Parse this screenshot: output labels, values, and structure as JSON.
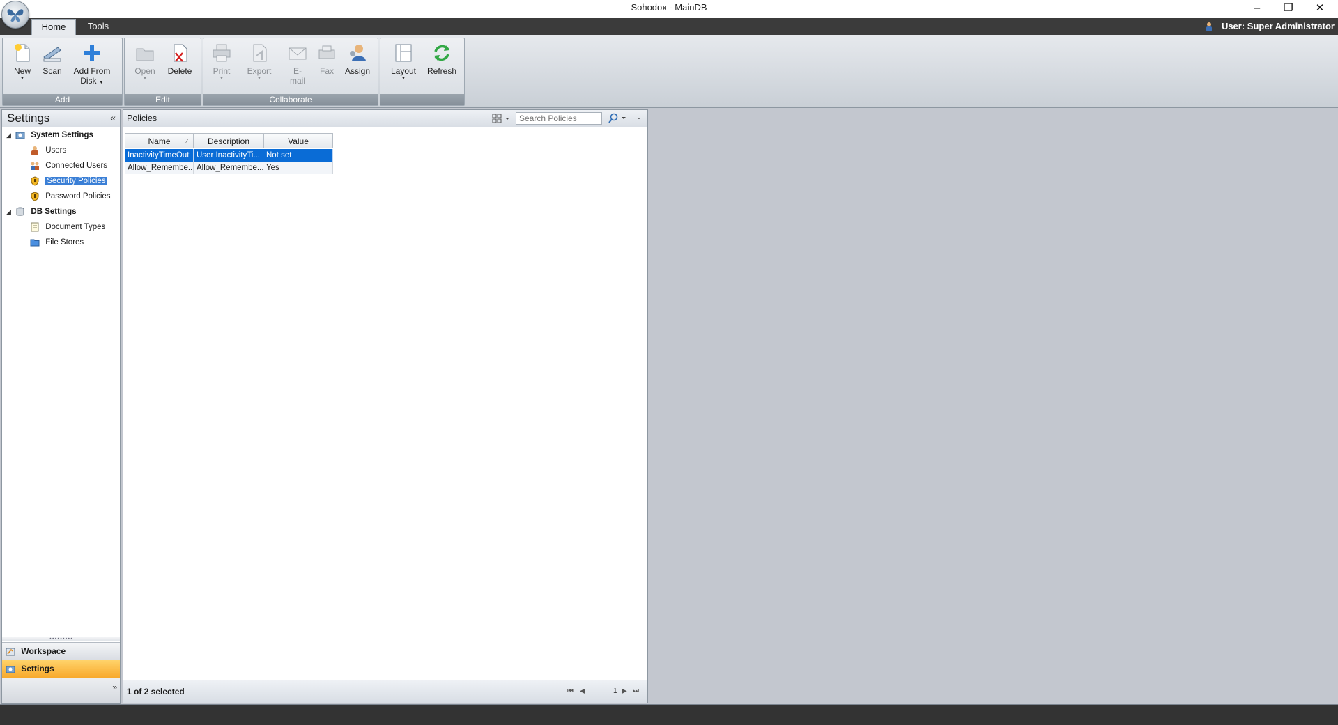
{
  "window": {
    "title": "Sohodox - MainDB",
    "minimize": "–",
    "restore": "❐",
    "close": "✕"
  },
  "tabs": {
    "home": "Home",
    "tools": "Tools"
  },
  "user": {
    "label": "User: Super Administrator"
  },
  "ribbon": {
    "add": {
      "label": "Add",
      "new": "New",
      "scan": "Scan",
      "add_from_disk_1": "Add From",
      "add_from_disk_2": "Disk"
    },
    "edit": {
      "label": "Edit",
      "open": "Open",
      "delete": "Delete"
    },
    "collaborate": {
      "label": "Collaborate",
      "print": "Print",
      "export": "Export",
      "email_1": "E-",
      "email_2": "mail",
      "fax": "Fax",
      "assign": "Assign"
    },
    "view": {
      "layout": "Layout",
      "refresh": "Refresh"
    }
  },
  "settings": {
    "title": "Settings",
    "collapse": "«",
    "system_settings": {
      "label": "System Settings",
      "items": [
        "Users",
        "Connected Users",
        "Security Policies",
        "Password Policies"
      ]
    },
    "db_settings": {
      "label": "DB Settings",
      "items": [
        "Document Types",
        "File Stores"
      ]
    }
  },
  "nav": {
    "workspace": "Workspace",
    "settings": "Settings",
    "chevron": "»"
  },
  "policies": {
    "title": "Policies",
    "search_placeholder": "Search Policies",
    "columns": {
      "name": "Name",
      "description": "Description",
      "value": "Value"
    },
    "rows": [
      {
        "name": "InactivityTimeOut",
        "description": "User InactivityTi...",
        "value": "Not set"
      },
      {
        "name": "Allow_Remembe...",
        "description": "Allow_Remembe...",
        "value": "Yes"
      }
    ],
    "status": "1 of 2 selected",
    "page": "1"
  },
  "colors": {
    "accent": "#0a6cd6",
    "nav_selected": "#f8a92c",
    "ribbon_group_label": "#86909a"
  }
}
